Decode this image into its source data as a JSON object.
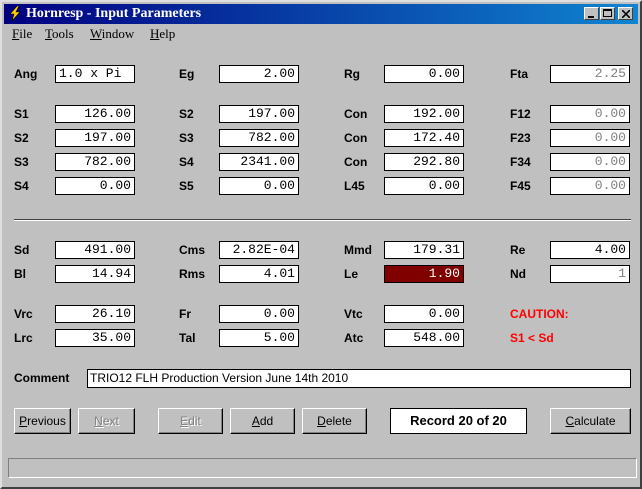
{
  "window": {
    "title": "Hornresp - Input Parameters"
  },
  "menu": [
    {
      "first": "F",
      "rest": "ile"
    },
    {
      "first": "T",
      "rest": "ools"
    },
    {
      "first": "W",
      "rest": "indow"
    },
    {
      "first": "H",
      "rest": "elp"
    }
  ],
  "params": {
    "Ang": {
      "label": "Ang",
      "value": "1.0 x Pi"
    },
    "Eg": {
      "label": "Eg",
      "value": "2.00"
    },
    "Rg": {
      "label": "Rg",
      "value": "0.00"
    },
    "Fta": {
      "label": "Fta",
      "value": "2.25"
    },
    "S1a": {
      "label": "S1",
      "value": "126.00"
    },
    "S2a": {
      "label": "S2",
      "value": "197.00"
    },
    "Con1": {
      "label": "Con",
      "value": "192.00"
    },
    "F12": {
      "label": "F12",
      "value": "0.00"
    },
    "S2b": {
      "label": "S2",
      "value": "197.00"
    },
    "S3a": {
      "label": "S3",
      "value": "782.00"
    },
    "Con2": {
      "label": "Con",
      "value": "172.40"
    },
    "F23": {
      "label": "F23",
      "value": "0.00"
    },
    "S3b": {
      "label": "S3",
      "value": "782.00"
    },
    "S4a": {
      "label": "S4",
      "value": "2341.00"
    },
    "Con3": {
      "label": "Con",
      "value": "292.80"
    },
    "F34": {
      "label": "F34",
      "value": "0.00"
    },
    "S4b": {
      "label": "S4",
      "value": "0.00"
    },
    "S5": {
      "label": "S5",
      "value": "0.00"
    },
    "L45": {
      "label": "L45",
      "value": "0.00"
    },
    "F45": {
      "label": "F45",
      "value": "0.00"
    },
    "Sd": {
      "label": "Sd",
      "value": "491.00"
    },
    "Cms": {
      "label": "Cms",
      "value": "2.82E-04"
    },
    "Mmd": {
      "label": "Mmd",
      "value": "179.31"
    },
    "Re": {
      "label": "Re",
      "value": "4.00"
    },
    "Bl": {
      "label": "Bl",
      "value": "14.94"
    },
    "Rms": {
      "label": "Rms",
      "value": "4.01"
    },
    "Le": {
      "label": "Le",
      "value": "1.90"
    },
    "Nd": {
      "label": "Nd",
      "value": "1"
    },
    "Vrc": {
      "label": "Vrc",
      "value": "26.10"
    },
    "Fr": {
      "label": "Fr",
      "value": "0.00"
    },
    "Vtc": {
      "label": "Vtc",
      "value": "0.00"
    },
    "Lrc": {
      "label": "Lrc",
      "value": "35.00"
    },
    "Tal": {
      "label": "Tal",
      "value": "5.00"
    },
    "Atc": {
      "label": "Atc",
      "value": "548.00"
    }
  },
  "caution": {
    "line1": "CAUTION:",
    "line2": "S1 < Sd"
  },
  "comment": {
    "label": "Comment",
    "value": "TRIO12 FLH Production Version June 14th 2010"
  },
  "buttons": {
    "previous": {
      "first": "P",
      "rest": "revious"
    },
    "next": {
      "first": "N",
      "rest": "ext"
    },
    "edit": {
      "first": "E",
      "rest": "dit"
    },
    "add": {
      "first": "A",
      "rest": "dd"
    },
    "delete": {
      "first": "D",
      "rest": "elete"
    },
    "calculate": {
      "first": "C",
      "rest": "alculate"
    }
  },
  "record": "Record 20 of 20",
  "colors": {
    "titlebar": "#000080",
    "selected_field": "#800000",
    "caution": "#ff0000"
  }
}
